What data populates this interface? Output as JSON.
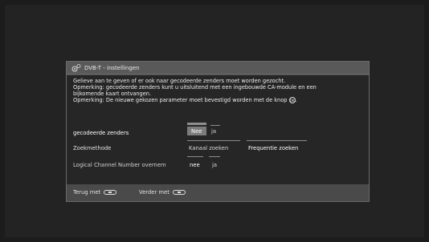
{
  "dialog": {
    "title": "DVB-T - instellingen",
    "messages": [
      "Gelieve aan te geven of er ook naar gecodeerde zenders moet worden gezocht.",
      "Opmerking: gecodeerde zenders kunt u uitsluitend met een ingebouwde CA-module en een",
      "bijkomende kaart ontvangen.",
      "Opmerking: De nieuwe gekozen parameter moet bevestigd worden met de knop"
    ],
    "ok_icon_text": "OK",
    "rows": [
      {
        "label": "gecodeerde zenders",
        "options": [
          "Nee",
          "ja"
        ],
        "selected": "Nee"
      },
      {
        "label": "Zoekmethode",
        "options": [
          "Kanaal zoeken",
          "Frequentie zoeken"
        ],
        "selected": "Frequentie zoeken"
      },
      {
        "label": "Logical Channel Number overnem",
        "options": [
          "nee",
          "ja"
        ],
        "selected": "nee"
      }
    ],
    "footer": {
      "back_label": "Terug met",
      "next_label": "Verder met"
    }
  }
}
